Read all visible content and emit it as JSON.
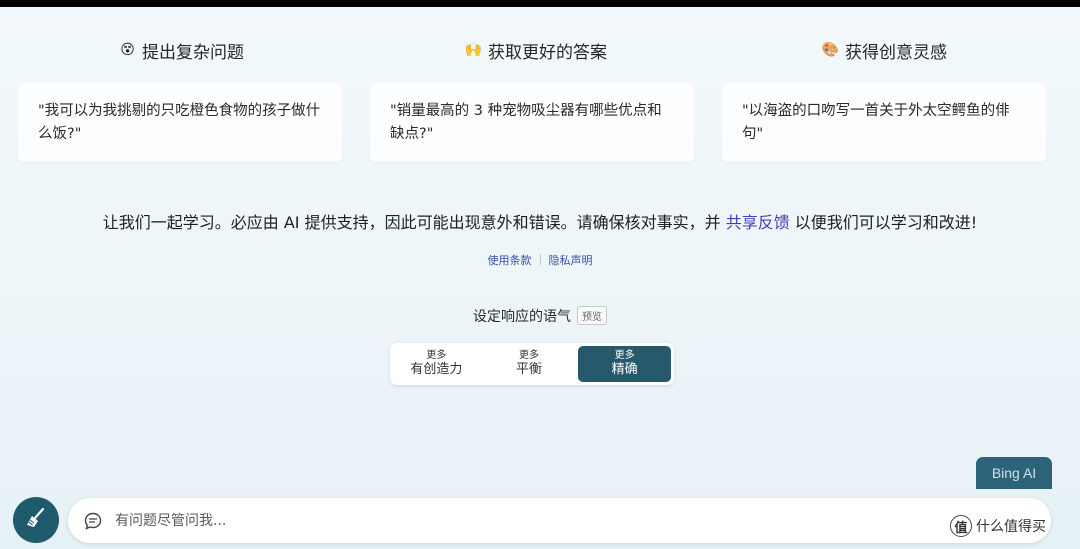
{
  "categories": [
    {
      "icon": "confused-face-icon",
      "emoji": "😵",
      "label": "提出复杂问题",
      "color": "#f4b63a"
    },
    {
      "icon": "raised-hands-icon",
      "emoji": "🙌",
      "label": "获取更好的答案",
      "color": "#f4b63a"
    },
    {
      "icon": "palette-icon",
      "emoji": "🎨",
      "label": "获得创意灵感",
      "color": "#e8a0a0"
    }
  ],
  "examples": [
    "\"我可以为我挑剔的只吃橙色食物的孩子做什么饭?\"",
    "\"销量最高的 3 种宠物吸尘器有哪些优点和缺点?\"",
    "\"以海盗的口吻写一首关于外太空鳄鱼的俳句\""
  ],
  "notice": {
    "before": "让我们一起学习。必应由 AI 提供支持，因此可能出现意外和错误。请确保核对事实，并 ",
    "link": "共享反馈",
    "after": " 以便我们可以学习和改进!"
  },
  "legal_links": {
    "terms": "使用条款",
    "privacy": "隐私声明"
  },
  "tone": {
    "title": "设定响应的语气",
    "badge": "预览",
    "options": [
      {
        "small": "更多",
        "big": "有创造力",
        "active": false
      },
      {
        "small": "更多",
        "big": "平衡",
        "active": false
      },
      {
        "small": "更多",
        "big": "精确",
        "active": true
      }
    ]
  },
  "bing_button": "Bing AI",
  "input": {
    "placeholder": "有问题尽管问我..."
  },
  "watermark": {
    "text": "什么值得买",
    "logo": "值"
  },
  "colors": {
    "accent": "#26596b",
    "link": "#3f3fb5",
    "broom_bg": "#1f5a6c"
  }
}
